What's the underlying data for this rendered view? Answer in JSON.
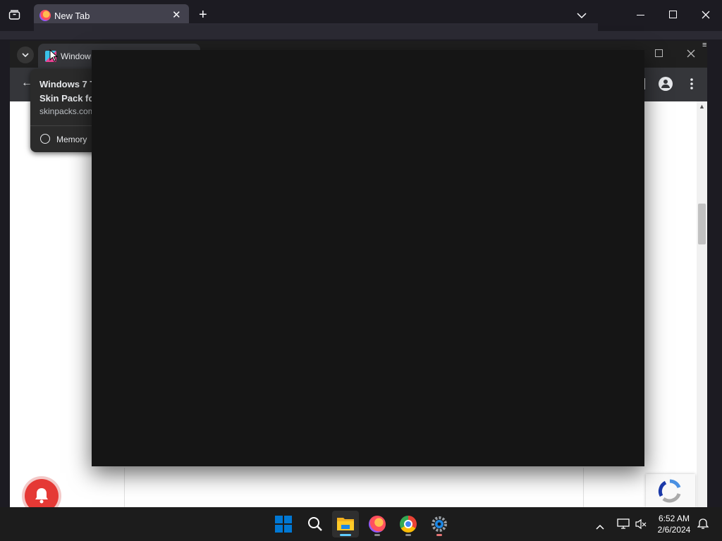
{
  "firefox": {
    "tab_title": "New Tab",
    "new_tab": "+",
    "close_tab": "✕"
  },
  "chrome": {
    "tab_title": "Window",
    "back": "←"
  },
  "hover_card": {
    "title_line1": "Windows 7 T",
    "title_line2": "Skin Pack for",
    "domain": "skinpacks.com",
    "memory_label": "Memory"
  },
  "taskbar": {
    "time": "6:52 AM",
    "date": "2/6/2024"
  },
  "colors": {
    "overlay": "#151515",
    "taskbar": "#1c1c1c",
    "accent": "#0078d4"
  }
}
